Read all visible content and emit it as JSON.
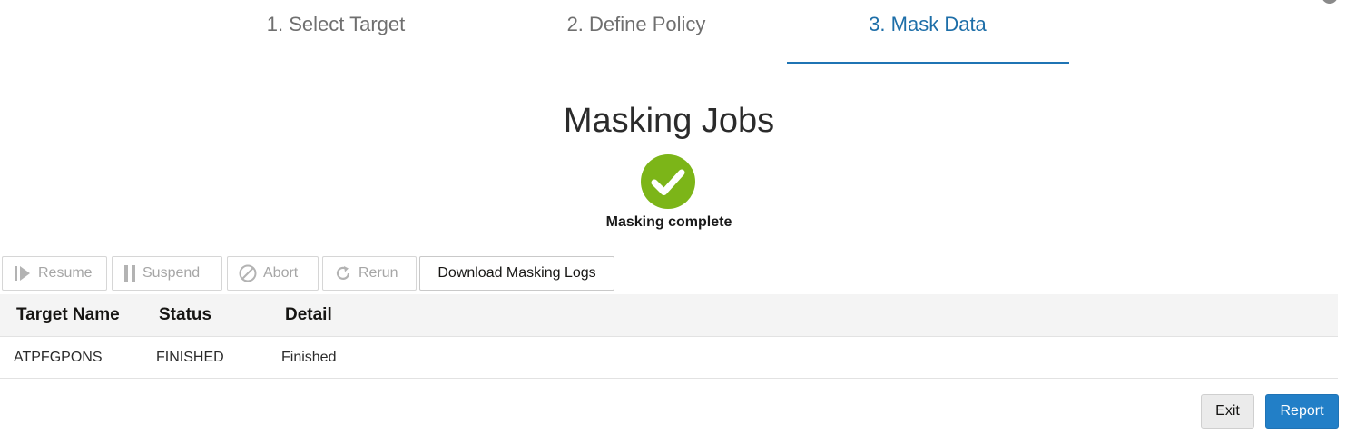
{
  "train": {
    "steps": [
      {
        "label": "1. Select Target",
        "active": false
      },
      {
        "label": "2. Define Policy",
        "active": false
      },
      {
        "label": "3. Mask Data",
        "active": true
      }
    ]
  },
  "page_title": "Masking Jobs",
  "status": {
    "icon": "check-circle-icon",
    "text": "Masking complete",
    "color": "#7cb518"
  },
  "toolbar": {
    "resume_label": "Resume",
    "suspend_label": "Suspend",
    "abort_label": "Abort",
    "rerun_label": "Rerun",
    "download_label": "Download Masking Logs"
  },
  "table": {
    "columns": [
      "Target Name",
      "Status",
      "Detail"
    ],
    "rows": [
      {
        "target_name": "ATPFGPONS",
        "status": "FINISHED",
        "detail": "Finished"
      }
    ]
  },
  "footer": {
    "exit_label": "Exit",
    "report_label": "Report"
  },
  "colors": {
    "accent": "#1f74b4",
    "primary_button": "#227fc7",
    "success": "#7cb518"
  }
}
